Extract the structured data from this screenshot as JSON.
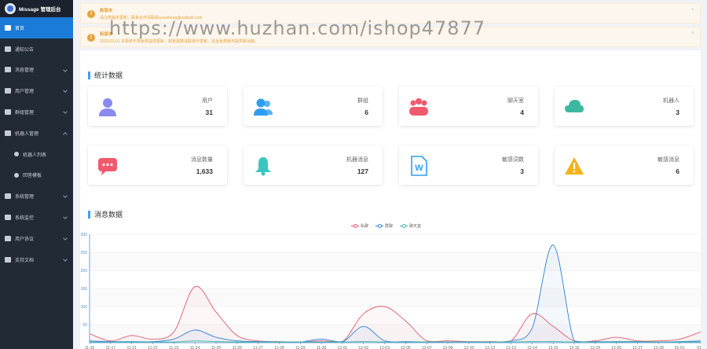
{
  "app": {
    "title": "Missage 管理后台"
  },
  "sidebar": {
    "items": [
      {
        "label": "首页",
        "active": true,
        "has_children": false
      },
      {
        "label": "通知公告",
        "has_children": false
      },
      {
        "label": "消息管理",
        "has_children": true
      },
      {
        "label": "用户管理",
        "has_children": true
      },
      {
        "label": "群组管理",
        "has_children": true
      },
      {
        "label": "机器人管理",
        "has_children": true,
        "expanded": true
      },
      {
        "label": "机器人列表",
        "sub": true
      },
      {
        "label": "回答模板",
        "sub": true
      },
      {
        "label": "系统管理",
        "has_children": true
      },
      {
        "label": "系统监控",
        "has_children": true
      },
      {
        "label": "用户协议",
        "has_children": true
      },
      {
        "label": "支持文档",
        "has_children": true
      }
    ]
  },
  "notices": [
    {
      "title": "新版本",
      "text": "请注意版本更新，联系合作请联系ryanzheng@outlook.com",
      "close": "×"
    },
    {
      "title": "新版本",
      "text": "2023-01-01 本系统不再免费提供更新，如有需要请联系开发者，完全免费版不提供新功能。",
      "close": "×"
    }
  ],
  "stats": {
    "title": "统计数据",
    "cards": [
      {
        "label": "用户",
        "value": "31",
        "icon": "user-icon",
        "color": "#8a8af0"
      },
      {
        "label": "群组",
        "value": "6",
        "icon": "group-icon",
        "color": "#2e9ef0"
      },
      {
        "label": "聊天室",
        "value": "4",
        "icon": "chatroom-icon",
        "color": "#f05a6e"
      },
      {
        "label": "机器人",
        "value": "3",
        "icon": "cloud-icon",
        "color": "#3cb8a0"
      },
      {
        "label": "消息数量",
        "value": "1,633",
        "icon": "message-icon",
        "color": "#f05a6e"
      },
      {
        "label": "机器消息",
        "value": "127",
        "icon": "bell-icon",
        "color": "#3cc6c0"
      },
      {
        "label": "敏感词数",
        "value": "3",
        "icon": "word-doc-icon",
        "color": "#2e9ef0"
      },
      {
        "label": "敏感消息",
        "value": "6",
        "icon": "warning-icon",
        "color": "#f5b21b"
      }
    ]
  },
  "messages": {
    "title": "消息数据"
  },
  "watermark": "https://www.huzhan.com/ishop47877",
  "chart_data": {
    "type": "line",
    "categories": [
      "11-16",
      "11-17",
      "11-21",
      "11-22",
      "11-23",
      "11-24",
      "11-25",
      "11-26",
      "11-27",
      "11-28",
      "11-29",
      "11-30",
      "12-01",
      "12-02",
      "12-03",
      "12-05",
      "12-07",
      "12-09",
      "12-10",
      "12-12",
      "12-13",
      "12-14",
      "12-15",
      "12-16",
      "12-25",
      "12-26",
      "12-27",
      "12-28",
      "01-01",
      "01-0"
    ],
    "y_ticks": [
      "300",
      "250",
      "200",
      "150",
      "100",
      "50"
    ],
    "ylim": [
      0,
      300
    ],
    "series": [
      {
        "name": "私聊",
        "color": "#e05a6e",
        "values": [
          25,
          5,
          20,
          10,
          30,
          155,
          85,
          20,
          5,
          3,
          2,
          5,
          3,
          80,
          100,
          60,
          5,
          5,
          3,
          3,
          5,
          80,
          45,
          5,
          5,
          15,
          5,
          5,
          10,
          30
        ]
      },
      {
        "name": "群聊",
        "color": "#2e7fd6",
        "values": [
          5,
          3,
          3,
          3,
          10,
          35,
          15,
          5,
          3,
          2,
          2,
          10,
          3,
          45,
          5,
          3,
          2,
          2,
          2,
          2,
          5,
          40,
          270,
          5,
          3,
          3,
          3,
          2,
          3,
          5
        ]
      },
      {
        "name": "聊天室",
        "color": "#3cb8a0",
        "values": [
          2,
          2,
          2,
          2,
          2,
          5,
          3,
          2,
          2,
          2,
          2,
          2,
          2,
          3,
          2,
          2,
          2,
          2,
          2,
          2,
          2,
          3,
          3,
          2,
          2,
          2,
          2,
          2,
          2,
          2
        ]
      }
    ]
  }
}
